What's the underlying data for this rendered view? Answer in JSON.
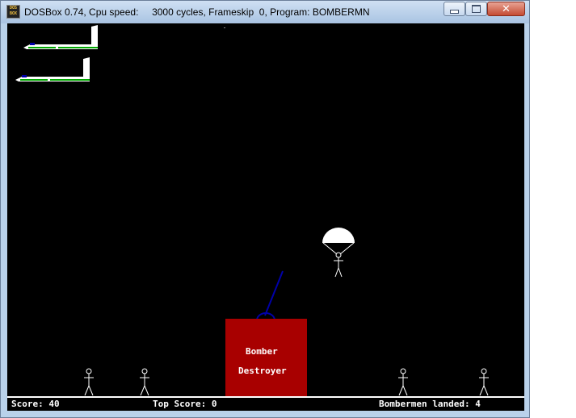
{
  "window": {
    "title": "DOSBox 0.74, Cpu speed:     3000 cycles, Frameskip  0, Program: BOMBERMN",
    "icon_label": "DOS BOX",
    "controls": {
      "minimize": "minimize-icon",
      "maximize": "maximize-icon",
      "close": "✕"
    }
  },
  "game": {
    "bunker": {
      "line1": "Bomber",
      "line2": "Destroyer"
    },
    "status": {
      "score": "Score: 40",
      "top_score": "Top Score: 0",
      "landed": "Bombermen landed: 4"
    },
    "colors": {
      "background": "#000000",
      "bunker": "#a80000",
      "gun": "#0000a8",
      "plane_stripe": "#00a800",
      "plane_window": "#0000a8",
      "text": "#ffffff"
    },
    "objects": {
      "planes": 2,
      "parachutists": 1,
      "landed_men": 4
    }
  }
}
